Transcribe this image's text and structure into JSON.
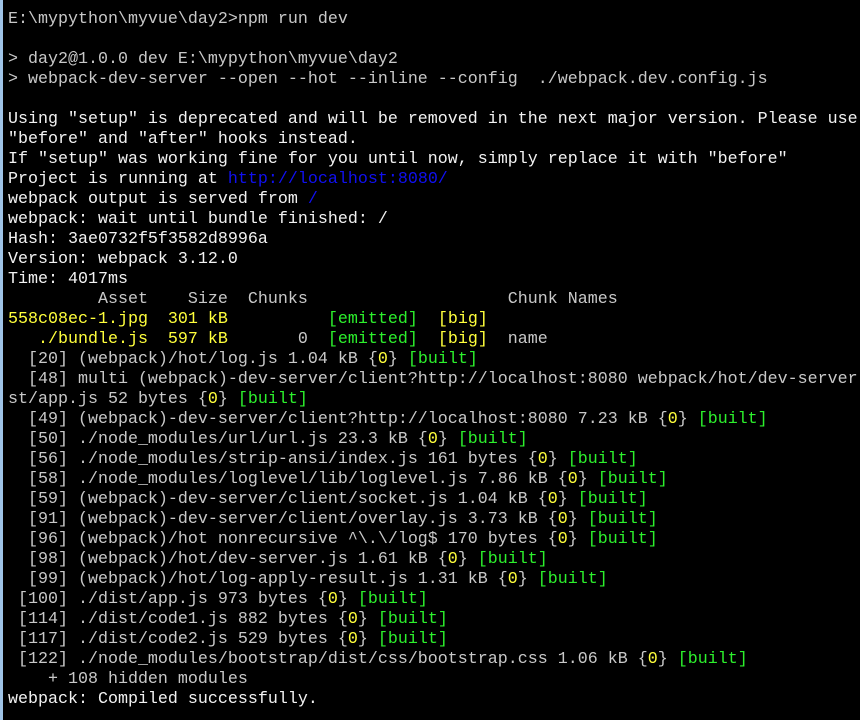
{
  "colors": {
    "gray": "#c8c8c8",
    "white": "#f2f2f2",
    "yellow": "#ffff3c",
    "green": "#2cf02c",
    "blue": "#1010f0",
    "background": "#000000"
  },
  "lines": [
    [
      [
        "E:\\mypython\\myvue\\day2>npm run dev",
        "gray"
      ]
    ],
    [],
    [
      [
        "> day2@1.0.0 dev E:\\mypython\\myvue\\day2",
        "gray"
      ]
    ],
    [
      [
        "> webpack-dev-server --open --hot --inline --config  ./webpack.dev.config.js",
        "gray"
      ]
    ],
    [],
    [
      [
        "Using \"setup\" is deprecated and will be removed in the next major version. Please use",
        "white"
      ]
    ],
    [
      [
        "\"before\" and \"after\" hooks instead.",
        "white"
      ]
    ],
    [
      [
        "If \"setup\" was working fine for you until now, simply replace it with \"before\"",
        "white"
      ]
    ],
    [
      [
        "Project is running at ",
        "white"
      ],
      [
        "http://localhost:8080/",
        "blue"
      ]
    ],
    [
      [
        "webpack output is served from ",
        "white"
      ],
      [
        "/",
        "blue"
      ]
    ],
    [
      [
        "webpack: wait until bundle finished: /",
        "white"
      ]
    ],
    [
      [
        "Hash: 3ae0732f5f3582d8996a",
        "white"
      ]
    ],
    [
      [
        "Version: webpack 3.12.0",
        "white"
      ]
    ],
    [
      [
        "Time: 4017ms",
        "white"
      ]
    ],
    [
      [
        "         Asset    Size  Chunks                    Chunk Names",
        "gray"
      ]
    ],
    [
      [
        "558c08ec-1.jpg  301 kB",
        "yellow"
      ],
      [
        "          ",
        "gray"
      ],
      [
        "[emitted]",
        "green"
      ],
      [
        "  [big]",
        "yellow"
      ]
    ],
    [
      [
        "   ./bundle.js  597 kB",
        "yellow"
      ],
      [
        "       0  ",
        "gray"
      ],
      [
        "[emitted]",
        "green"
      ],
      [
        "  [big]",
        "yellow"
      ],
      [
        "  name",
        "gray"
      ]
    ],
    [
      [
        "  [20] (webpack)/hot/log.js 1.04 kB {",
        "gray"
      ],
      [
        "0",
        "yellow"
      ],
      [
        "} ",
        "gray"
      ],
      [
        "[built]",
        "green"
      ]
    ],
    [
      [
        "  [48] multi (webpack)-dev-server/client?http://localhost:8080 webpack/hot/dev-server",
        "gray"
      ]
    ],
    [
      [
        "st/app.js 52 bytes {",
        "gray"
      ],
      [
        "0",
        "yellow"
      ],
      [
        "} ",
        "gray"
      ],
      [
        "[built]",
        "green"
      ]
    ],
    [
      [
        "  [49] (webpack)-dev-server/client?http://localhost:8080 7.23 kB {",
        "gray"
      ],
      [
        "0",
        "yellow"
      ],
      [
        "} ",
        "gray"
      ],
      [
        "[built]",
        "green"
      ]
    ],
    [
      [
        "  [50] ./node_modules/url/url.js 23.3 kB {",
        "gray"
      ],
      [
        "0",
        "yellow"
      ],
      [
        "} ",
        "gray"
      ],
      [
        "[built]",
        "green"
      ]
    ],
    [
      [
        "  [56] ./node_modules/strip-ansi/index.js 161 bytes {",
        "gray"
      ],
      [
        "0",
        "yellow"
      ],
      [
        "} ",
        "gray"
      ],
      [
        "[built]",
        "green"
      ]
    ],
    [
      [
        "  [58] ./node_modules/loglevel/lib/loglevel.js 7.86 kB {",
        "gray"
      ],
      [
        "0",
        "yellow"
      ],
      [
        "} ",
        "gray"
      ],
      [
        "[built]",
        "green"
      ]
    ],
    [
      [
        "  [59] (webpack)-dev-server/client/socket.js 1.04 kB {",
        "gray"
      ],
      [
        "0",
        "yellow"
      ],
      [
        "} ",
        "gray"
      ],
      [
        "[built]",
        "green"
      ]
    ],
    [
      [
        "  [91] (webpack)-dev-server/client/overlay.js 3.73 kB {",
        "gray"
      ],
      [
        "0",
        "yellow"
      ],
      [
        "} ",
        "gray"
      ],
      [
        "[built]",
        "green"
      ]
    ],
    [
      [
        "  [96] (webpack)/hot nonrecursive ^\\.\\/log$ 170 bytes {",
        "gray"
      ],
      [
        "0",
        "yellow"
      ],
      [
        "} ",
        "gray"
      ],
      [
        "[built]",
        "green"
      ]
    ],
    [
      [
        "  [98] (webpack)/hot/dev-server.js 1.61 kB {",
        "gray"
      ],
      [
        "0",
        "yellow"
      ],
      [
        "} ",
        "gray"
      ],
      [
        "[built]",
        "green"
      ]
    ],
    [
      [
        "  [99] (webpack)/hot/log-apply-result.js 1.31 kB {",
        "gray"
      ],
      [
        "0",
        "yellow"
      ],
      [
        "} ",
        "gray"
      ],
      [
        "[built]",
        "green"
      ]
    ],
    [
      [
        " [100] ./dist/app.js 973 bytes {",
        "gray"
      ],
      [
        "0",
        "yellow"
      ],
      [
        "} ",
        "gray"
      ],
      [
        "[built]",
        "green"
      ]
    ],
    [
      [
        " [114] ./dist/code1.js 882 bytes {",
        "gray"
      ],
      [
        "0",
        "yellow"
      ],
      [
        "} ",
        "gray"
      ],
      [
        "[built]",
        "green"
      ]
    ],
    [
      [
        " [117] ./dist/code2.js 529 bytes {",
        "gray"
      ],
      [
        "0",
        "yellow"
      ],
      [
        "} ",
        "gray"
      ],
      [
        "[built]",
        "green"
      ]
    ],
    [
      [
        " [122] ./node_modules/bootstrap/dist/css/bootstrap.css 1.06 kB {",
        "gray"
      ],
      [
        "0",
        "yellow"
      ],
      [
        "} ",
        "gray"
      ],
      [
        "[built]",
        "green"
      ]
    ],
    [
      [
        "    + 108 hidden modules",
        "gray"
      ]
    ],
    [
      [
        "webpack: Compiled successfully.",
        "white"
      ]
    ]
  ]
}
